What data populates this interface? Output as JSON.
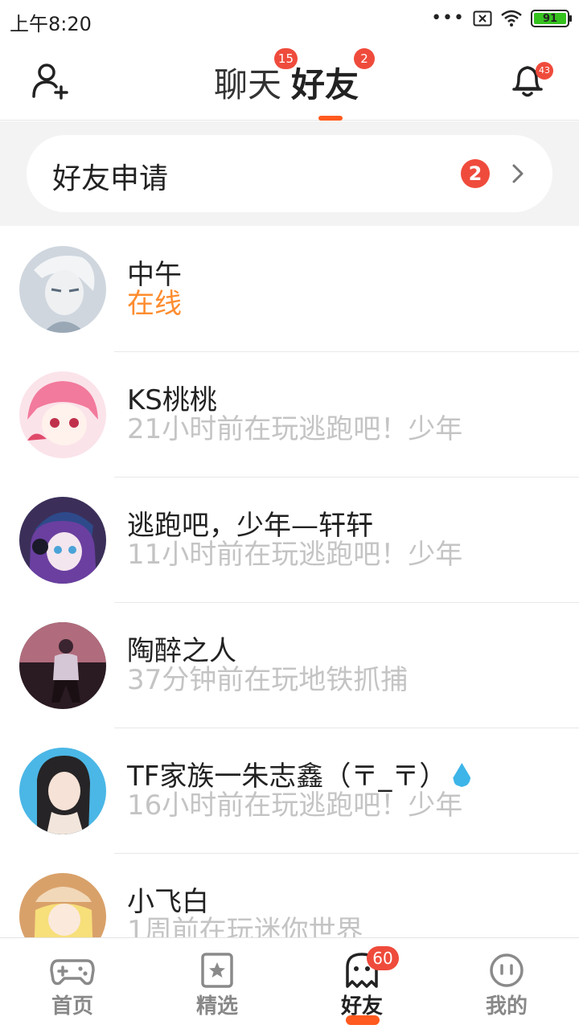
{
  "status_bar": {
    "time": "上午8:20",
    "battery": "91",
    "dots": "•••"
  },
  "header": {
    "tabs": [
      {
        "label": "聊天",
        "badge": "15"
      },
      {
        "label": "好友",
        "badge": "2"
      }
    ],
    "notification_badge": "43"
  },
  "friend_request": {
    "label": "好友申请",
    "count": "2"
  },
  "friends": [
    {
      "name": "中午",
      "status": "在线"
    },
    {
      "name": "KS桃桃",
      "status": "21小时前在玩逃跑吧！少年"
    },
    {
      "name": "逃跑吧，少年—轩轩",
      "status": "11小时前在玩逃跑吧！少年"
    },
    {
      "name": "陶醉之人",
      "status": "37分钟前在玩地铁抓捕"
    },
    {
      "name": "TF家族一朱志鑫（〒_〒）",
      "status": "16小时前在玩逃跑吧！少年"
    },
    {
      "name": "小飞白",
      "status": "1周前在玩迷你世界"
    }
  ],
  "bottom_nav": [
    {
      "label": "首页",
      "icon": "gamepad-icon"
    },
    {
      "label": "精选",
      "icon": "star-card-icon"
    },
    {
      "label": "好友",
      "icon": "ghost-icon",
      "badge": "60"
    },
    {
      "label": "我的",
      "icon": "face-icon"
    }
  ],
  "colors": {
    "accent": "#ff5a1f",
    "badge": "#ef4b3c",
    "online": "#ff8c2e",
    "battery": "#35c21f"
  }
}
